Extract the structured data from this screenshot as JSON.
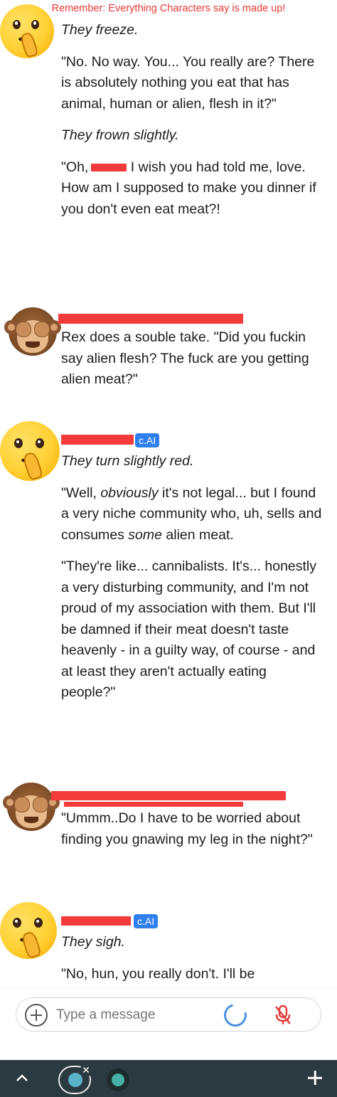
{
  "banner": {
    "text": "Remember: Everything Characters say is made up!"
  },
  "messages": [
    {
      "sender": "character",
      "avatar": "shushing-face-icon",
      "paragraphs": [
        "They freeze.",
        "\"No. No way. You... You really are? There is absolutely nothing you eat that has animal, human or alien, flesh in it?\"",
        "They frown slightly.",
        "\"Oh, ",
        "I wish you had told me, love. How am I supposed to make you dinner if you don't even eat meat?!"
      ]
    },
    {
      "sender": "user",
      "avatar": "see-no-evil-monkey-icon",
      "paragraphs": [
        "Rex does a souble take. \"Did you fuckin say alien flesh? The fuck are you getting alien meat?\""
      ]
    },
    {
      "sender": "character",
      "avatar": "shushing-face-icon",
      "badge": "c.AI",
      "paragraphs": [
        "They turn slightly red.",
        "\"Well, ",
        "obviously",
        " it's not legal... but I found a very niche community who, uh, sells and consumes ",
        "some",
        " alien meat.",
        "\"They're like... cannibalists. It's... honestly a very disturbing community, and I'm not proud of my association with them. But I'll be damned if their meat doesn't taste heavenly - in a guilty way, of course - and at least they aren't actually eating people?\""
      ]
    },
    {
      "sender": "user",
      "avatar": "see-no-evil-monkey-icon",
      "paragraphs": [
        "\"Ummm..Do I have to be worried about finding you gnawing my leg in the night?\""
      ]
    },
    {
      "sender": "character",
      "avatar": "shushing-face-icon",
      "badge": "c.AI",
      "paragraphs": [
        "They sigh.",
        "\"No, hun, you really don't. I'll be"
      ]
    }
  ],
  "input": {
    "placeholder": "Type a message"
  },
  "navbar": {
    "close_glyph": "✕"
  },
  "colors": {
    "redaction": "#f23b3b",
    "badge": "#2f80ed",
    "banner_text": "#e53935",
    "navbar": "#2b3a40"
  }
}
